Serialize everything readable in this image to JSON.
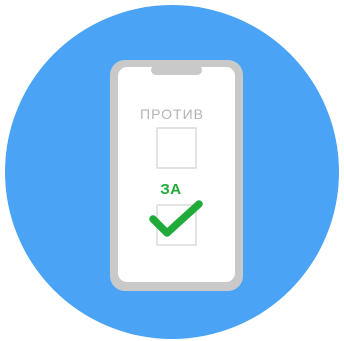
{
  "icon": {
    "name": "phone-voting-icon",
    "background_color": "#4aa3f5",
    "phone_frame_color": "#c9c9c9",
    "screen_color": "#ffffff",
    "checkbox_border_color": "#d6d6d6",
    "check_color": "#1faa3a"
  },
  "ballot": {
    "against_label": "ПРОТИВ",
    "against_checked": false,
    "for_label": "ЗА",
    "for_checked": true
  }
}
